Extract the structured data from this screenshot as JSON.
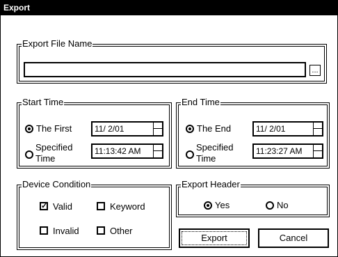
{
  "window": {
    "title": "Export"
  },
  "file_group": {
    "legend": "Export File Name",
    "value": "",
    "browse_label": "..."
  },
  "start_group": {
    "legend": "Start Time",
    "option1": "The First",
    "option2_line1": "Specified",
    "option2_line2": "Time",
    "date": "11/  2/01",
    "time": "11:13:42 AM"
  },
  "end_group": {
    "legend": "End Time",
    "option1": "The End",
    "option2_line1": "Specified",
    "option2_line2": "Time",
    "date": "11/  2/01",
    "time": "11:23:27 AM"
  },
  "device_group": {
    "legend": "Device Condition",
    "valid": "Valid",
    "keyword": "Keyword",
    "invalid": "Invalid",
    "other": "Other"
  },
  "header_group": {
    "legend": "Export Header",
    "yes": "Yes",
    "no": "No"
  },
  "buttons": {
    "export": "Export",
    "cancel": "Cancel"
  }
}
